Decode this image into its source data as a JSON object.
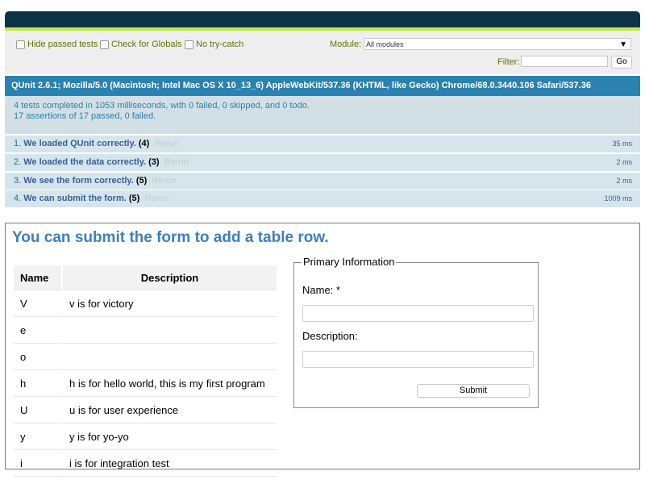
{
  "toolbar": {
    "hide_passed": "Hide passed tests",
    "check_globals": "Check for Globals",
    "no_try_catch": "No try-catch",
    "module_label": "Module:",
    "module_value": "All modules",
    "filter_label": "Filter:",
    "filter_value": "",
    "go_label": "Go"
  },
  "user_agent": "QUnit 2.6.1; Mozilla/5.0 (Macintosh; Intel Mac OS X 10_13_6) AppleWebKit/537.36 (KHTML, like Gecko) Chrome/68.0.3440.106 Safari/537.36",
  "test_result": {
    "line1": "4 tests completed in 1053 milliseconds, with 0 failed, 0 skipped, and 0 todo.",
    "line2": "17 assertions of 17 passed, 0 failed."
  },
  "tests": [
    {
      "index": "1.",
      "name": "We loaded QUnit correctly.",
      "counts": "(4)",
      "rerun": "Rerun",
      "runtime": "35 ms"
    },
    {
      "index": "2.",
      "name": "We loaded the data correctly.",
      "counts": "(3)",
      "rerun": "Rerun",
      "runtime": "2 ms"
    },
    {
      "index": "3.",
      "name": "We see the form correctly.",
      "counts": "(5)",
      "rerun": "Rerun",
      "runtime": "2 ms"
    },
    {
      "index": "4.",
      "name": "We can submit the form.",
      "counts": "(5)",
      "rerun": "Rerun",
      "runtime": "1009 ms"
    }
  ],
  "app": {
    "title": "You can submit the form to add a table row.",
    "table": {
      "headers": [
        "Name",
        "Description"
      ],
      "rows": [
        {
          "name": "V",
          "description": "v is for victory"
        },
        {
          "name": "e",
          "description": ""
        },
        {
          "name": "o",
          "description": ""
        },
        {
          "name": "h",
          "description": "h is for hello world, this is my first program"
        },
        {
          "name": "U",
          "description": "u is for user experience"
        },
        {
          "name": "y",
          "description": "y is for yo-yo"
        },
        {
          "name": "i",
          "description": "i is for integration test"
        }
      ]
    },
    "form": {
      "legend": "Primary Information",
      "name_label": "Name: *",
      "name_value": "",
      "description_label": "Description:",
      "description_value": "",
      "submit_label": "Submit"
    }
  },
  "colors": {
    "header": "#0d3349",
    "banner": "#c6e746",
    "user_agent_bg": "#2b81af",
    "pass_bg": "#d6e5ec",
    "title": "#3d7fbe"
  }
}
